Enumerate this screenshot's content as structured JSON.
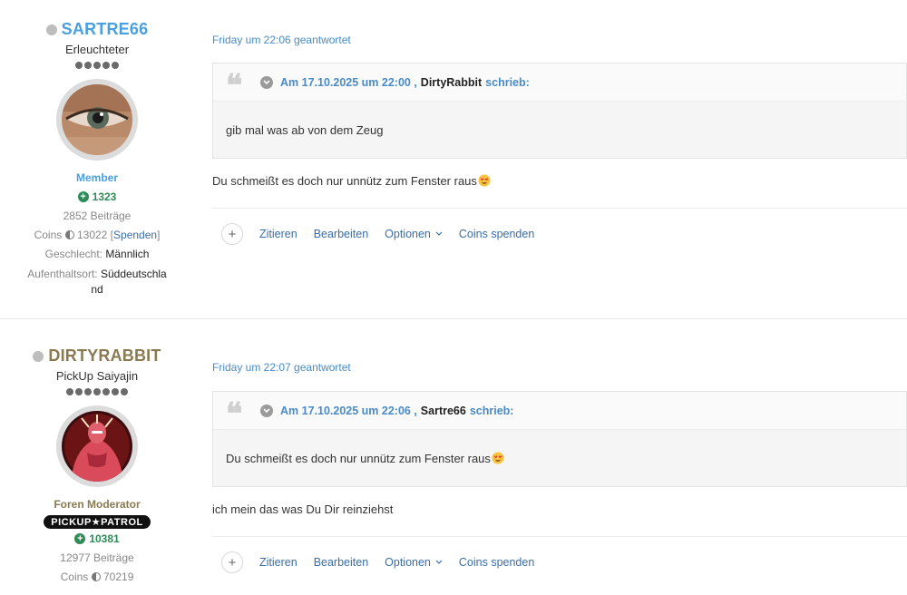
{
  "posts": [
    {
      "author": {
        "username": "SARTRE66",
        "username_color": "#4a9fe0",
        "rank_title": "Erleuchteter",
        "pips": 5,
        "role": "Member",
        "role_color": "#4a9fe0",
        "points": "1323",
        "posts_count": "2852 Beiträge",
        "coins_label": "Coins",
        "coins_value": "13022",
        "donate_label": "Spenden",
        "gender_label": "Geschlecht:",
        "gender_value": "Männlich",
        "location_label": "Aufenthaltsort:",
        "location_value": "Süddeutschla nd"
      },
      "meta": "Friday um 22:06 geantwortet",
      "quote": {
        "date": "Am 17.10.2025 um 22:00 ,",
        "user": "DirtyRabbit",
        "says": "schrieb:",
        "text": "gib mal was ab von dem Zeug"
      },
      "message": "Du schmeißt es doch nur unnütz zum Fenster raus",
      "actions": [
        "Zitieren",
        "Bearbeiten",
        "Optionen",
        "Coins spenden"
      ]
    },
    {
      "author": {
        "username": "DIRTYRABBIT",
        "username_color": "#8a7a50",
        "rank_title": "PickUp Saiyajin",
        "pips": 7,
        "role": "Foren Moderator",
        "role_color": "#8a7a50",
        "badge": "PICKUP★PATROL",
        "points": "10381",
        "posts_count": "12977 Beiträge",
        "coins_label": "Coins",
        "coins_value": "70219"
      },
      "meta": "Friday um 22:07 geantwortet",
      "quote": {
        "date": "Am 17.10.2025 um 22:06 ,",
        "user": "Sartre66",
        "says": "schrieb:",
        "text": "Du schmeißt es doch nur unnütz zum Fenster raus"
      },
      "message": "ich mein das was Du Dir reinziehst",
      "actions": [
        "Zitieren",
        "Bearbeiten",
        "Optionen",
        "Coins spenden"
      ]
    }
  ]
}
